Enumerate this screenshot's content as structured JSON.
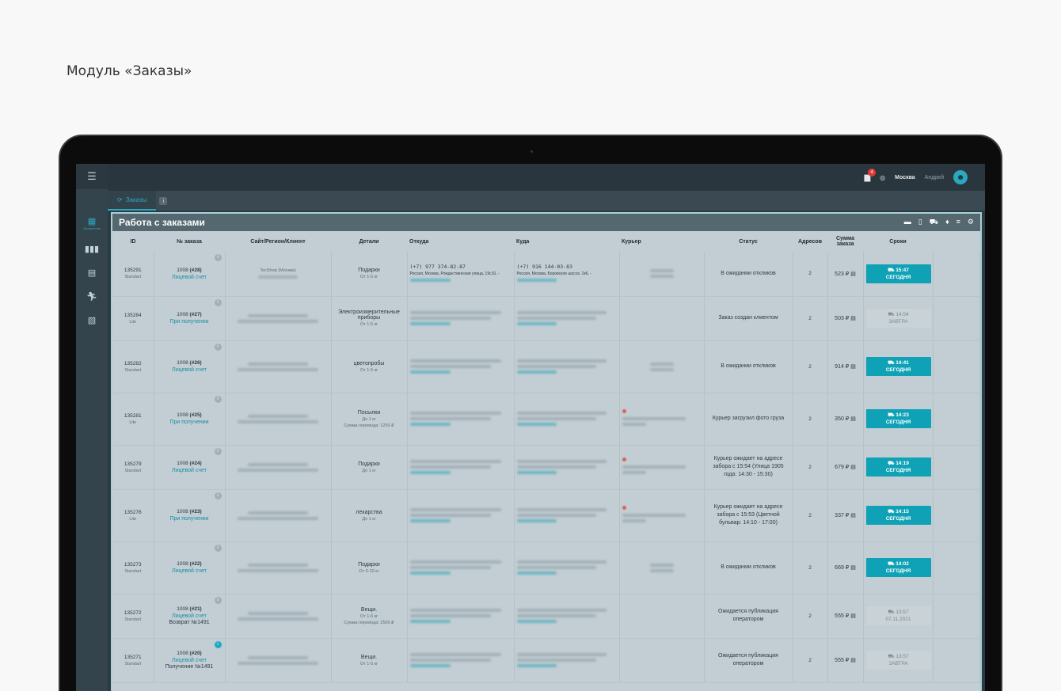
{
  "page_heading": "Модуль «Заказы»",
  "topbar": {
    "notifications_count": "4",
    "city": "Москва",
    "user_name": "Андрей"
  },
  "sidebar": {
    "active_label": "Управление"
  },
  "tabs": [
    {
      "label": "Заказы"
    }
  ],
  "panel": {
    "title": "Работа с заказами"
  },
  "table": {
    "headers": [
      "ID",
      "№ заказа",
      "Сайт/Регион/Клиент",
      "Детали",
      "Откуда",
      "Куда",
      "Курьер",
      "Статус",
      "Адресов",
      "Сумма заказа",
      "Сроки"
    ],
    "rows": [
      {
        "id": "135291",
        "plan": "Standart",
        "order_num": "1008",
        "order_suffix": "(#28)",
        "payment": "Лицевой счет",
        "extra": "",
        "client": "TecShop (Москва)",
        "details_1": "Подарки",
        "details_2": "От 1-5 кг",
        "details_3": "",
        "from_phone": "(+7) 977 374-82-87",
        "from_addr": "Россия, Москва, Рождественская улица, 19с10, -",
        "to_phone": "(+7) 916 144-03-83",
        "to_addr": "Россия, Москва, Боровское шоссе, 2к6, -",
        "status": "В ожидании откликов",
        "addresses": "2",
        "sum": "523 ₽",
        "deadline_time": "15:47",
        "deadline_day": "СЕГОДНЯ",
        "deadline_today": true
      },
      {
        "id": "135284",
        "plan": "Lite",
        "order_num": "1008",
        "order_suffix": "(#27)",
        "payment": "При получении",
        "extra": "",
        "client": "",
        "details_1": "Электроизмерительные приборы",
        "details_2": "От 1-5 кг",
        "details_3": "",
        "from_phone": "",
        "from_addr": "",
        "to_phone": "",
        "to_addr": "",
        "status": "Заказ создан клиентом",
        "addresses": "2",
        "sum": "503 ₽",
        "deadline_time": "14:54",
        "deadline_day": "ЗАВТРА",
        "deadline_today": false
      },
      {
        "id": "135282",
        "plan": "Standart",
        "order_num": "1008",
        "order_suffix": "(#26)",
        "payment": "Лицевой счет",
        "extra": "",
        "client": "",
        "details_1": "цветопробы",
        "details_2": "От 1-5 кг",
        "details_3": "",
        "from_phone": "",
        "from_addr": "",
        "to_phone": "",
        "to_addr": "",
        "status": "В ожидании откликов",
        "addresses": "2",
        "sum": "914 ₽",
        "deadline_time": "14:41",
        "deadline_day": "СЕГОДНЯ",
        "deadline_today": true
      },
      {
        "id": "135281",
        "plan": "Lite",
        "order_num": "1008",
        "order_suffix": "(#25)",
        "payment": "При получении",
        "extra": "",
        "client": "",
        "details_1": "Посылки",
        "details_2": "До 1 кг",
        "details_3": "Сумма перевода: 1250 ₽",
        "from_phone": "",
        "from_addr": "",
        "to_phone": "",
        "to_addr": "",
        "status": "Курьер загрузил фото груза",
        "addresses": "2",
        "sum": "350 ₽",
        "deadline_time": "14:23",
        "deadline_day": "СЕГОДНЯ",
        "deadline_today": true
      },
      {
        "id": "135279",
        "plan": "Standart",
        "order_num": "1008",
        "order_suffix": "(#24)",
        "payment": "Лицевой счет",
        "extra": "",
        "client": "",
        "details_1": "Подарки",
        "details_2": "До 1 кг",
        "details_3": "",
        "from_phone": "",
        "from_addr": "",
        "to_phone": "",
        "to_addr": "",
        "status": "Курьер ожидает на адресе забора с 15:54 (Улица 1905 года: 14:30 - 15:30)",
        "addresses": "2",
        "sum": "679 ₽",
        "deadline_time": "14:19",
        "deadline_day": "СЕГОДНЯ",
        "deadline_today": true
      },
      {
        "id": "135276",
        "plan": "Lite",
        "order_num": "1008",
        "order_suffix": "(#23)",
        "payment": "При получении",
        "extra": "",
        "client": "",
        "details_1": "лекарства",
        "details_2": "До 1 кг",
        "details_3": "",
        "from_phone": "",
        "from_addr": "",
        "to_phone": "",
        "to_addr": "",
        "status": "Курьер ожидает на адресе забора с 15:53 (Цветной бульвар: 14:10 - 17:00)",
        "addresses": "2",
        "sum": "337 ₽",
        "deadline_time": "14:15",
        "deadline_day": "СЕГОДНЯ",
        "deadline_today": true
      },
      {
        "id": "135273",
        "plan": "Standart",
        "order_num": "1008",
        "order_suffix": "(#22)",
        "payment": "Лицевой счет",
        "extra": "",
        "client": "",
        "details_1": "Подарки",
        "details_2": "От 5-10 кг",
        "details_3": "",
        "from_phone": "",
        "from_addr": "",
        "to_phone": "",
        "to_addr": "",
        "status": "В ожидании откликов",
        "addresses": "2",
        "sum": "669 ₽",
        "deadline_time": "14:02",
        "deadline_day": "СЕГОДНЯ",
        "deadline_today": true
      },
      {
        "id": "135272",
        "plan": "Standart",
        "order_num": "1008",
        "order_suffix": "(#21)",
        "payment": "Лицевой счет",
        "extra": "Возврат №1491",
        "client": "",
        "details_1": "Вещи.",
        "details_2": "От 1-5 кг",
        "details_3": "Сумма перевода: 2500 ₽",
        "from_phone": "",
        "from_addr": "",
        "to_phone": "",
        "to_addr": "",
        "status": "Ожидается публикация оператором",
        "addresses": "2",
        "sum": "555 ₽",
        "deadline_time": "13:57",
        "deadline_day": "07.11.2021",
        "deadline_today": false
      },
      {
        "id": "135271",
        "plan": "Standart",
        "order_num": "1008",
        "order_suffix": "(#20)",
        "payment": "Лицевой счет",
        "extra": "Получение №1491",
        "client": "",
        "details_1": "Вещи.",
        "details_2": "От 1-5 кг",
        "details_3": "",
        "from_phone": "",
        "from_addr": "",
        "to_phone": "",
        "to_addr": "",
        "status": "Ожидается публикация оператором",
        "addresses": "2",
        "sum": "555 ₽",
        "deadline_time": "13:57",
        "deadline_day": "ЗАВТРА",
        "deadline_today": false
      }
    ]
  },
  "colors": {
    "accent": "#0fa2b6",
    "sidebar": "#34444c",
    "topbar": "#2a363d",
    "panel": "#c2ced4"
  }
}
